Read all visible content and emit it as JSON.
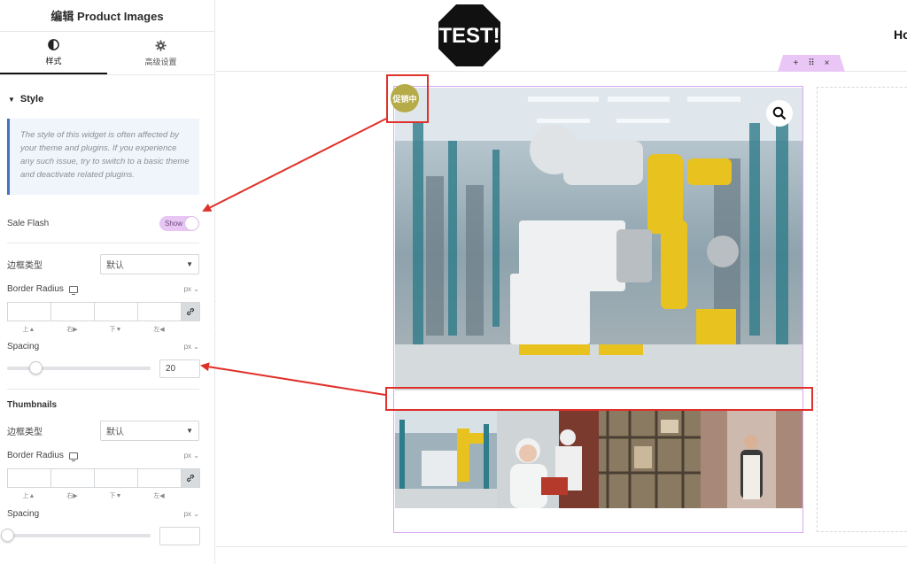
{
  "panel": {
    "title": "编辑 Product Images",
    "tabs": [
      {
        "label": "样式",
        "icon": "half-circle-icon"
      },
      {
        "label": "高级设置",
        "icon": "gear-icon"
      }
    ],
    "section": "Style",
    "notice": "The style of this widget is often affected by your theme and plugins. If you experience any such issue, try to switch to a basic theme and deactivate related plugins.",
    "sale_flash": {
      "label": "Sale Flash",
      "toggle": "Show"
    },
    "border_type": {
      "label": "边框类型",
      "value": "默认"
    },
    "border_radius": {
      "label": "Border Radius",
      "unit": "px"
    },
    "dim_labels": [
      "上▲",
      "右▶",
      "下▼",
      "左◀"
    ],
    "spacing": {
      "label": "Spacing",
      "unit": "px",
      "value": "20",
      "level": 0.2
    },
    "thumbnails": {
      "title": "Thumbnails",
      "border_type": {
        "label": "边框类型",
        "value": "默认"
      },
      "border_radius": {
        "label": "Border Radius",
        "unit": "px"
      },
      "spacing": {
        "label": "Spacing",
        "unit": "px",
        "value": "",
        "level": 0
      }
    }
  },
  "preview": {
    "logo_text": "TEST!",
    "nav_partial": "Ho",
    "handle": {
      "add": "+",
      "move": "⠿",
      "close": "×"
    },
    "sale_badge": "促销中",
    "accent": "#d9a8ef",
    "annotation_color": "#e0302a"
  }
}
